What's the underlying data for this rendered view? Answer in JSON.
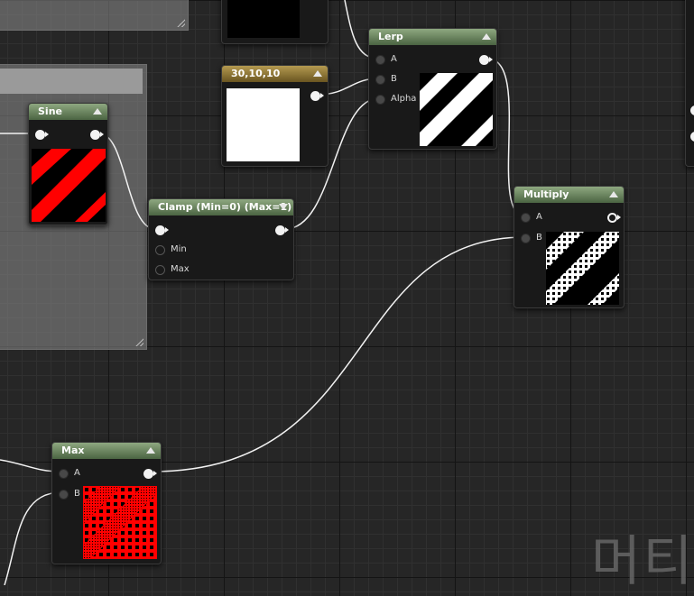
{
  "nodes": {
    "lerp": {
      "title": "Lerp",
      "inputs": [
        "A",
        "B",
        "Alpha"
      ]
    },
    "constant": {
      "title": "30,10,10"
    },
    "sine": {
      "title": "Sine"
    },
    "clamp": {
      "title": "Clamp (Min=0) (Max=1)",
      "inputs": [
        "Min",
        "Max"
      ]
    },
    "multiply": {
      "title": "Multiply",
      "inputs": [
        "A",
        "B"
      ]
    },
    "max": {
      "title": "Max",
      "inputs": [
        "A",
        "B"
      ]
    }
  },
  "watermark": "머티",
  "colors": {
    "canvas": "#262626",
    "grid_major": "#141414",
    "grid_minor": "#303030",
    "header_green": "#6b8560",
    "header_gold": "#8f7836",
    "wire": "#f2f2f2",
    "preview_red": "#ff0000"
  }
}
